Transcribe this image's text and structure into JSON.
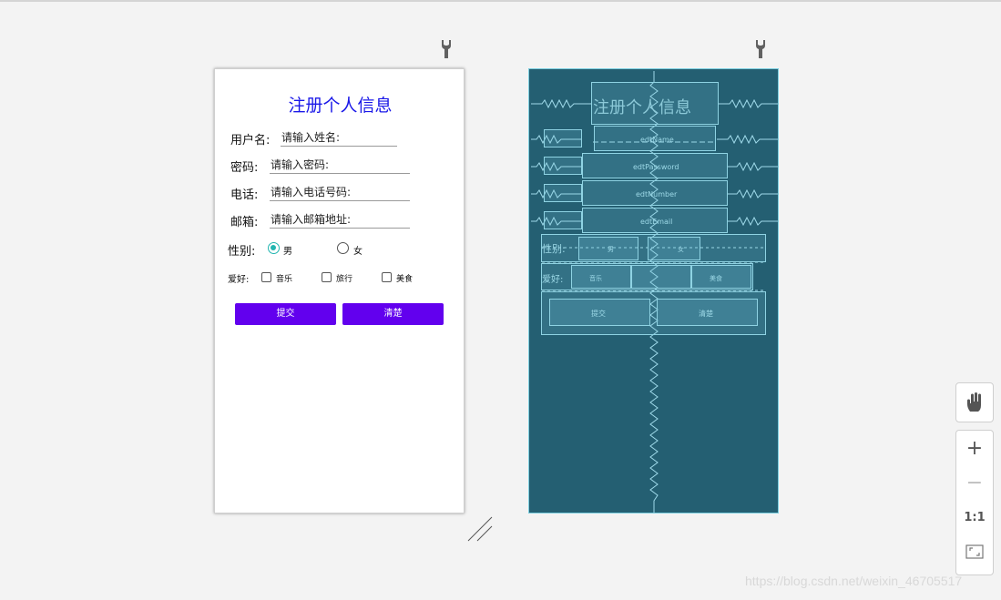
{
  "form": {
    "title": "注册个人信息",
    "username_label": "用户名:",
    "username_placeholder": "请输入姓名:",
    "password_label": "密码:",
    "password_placeholder": "请输入密码:",
    "phone_label": "电话:",
    "phone_placeholder": "请输入电话号码:",
    "email_label": "邮箱:",
    "email_placeholder": "请输入邮箱地址:",
    "gender_label": "性别:",
    "gender_options": [
      "男",
      "女"
    ],
    "gender_selected": "男",
    "hobby_label": "爱好:",
    "hobby_options": [
      "音乐",
      "旅行",
      "美食"
    ],
    "submit_label": "提交",
    "clear_label": "清楚"
  },
  "blueprint": {
    "title": "注册个人信息",
    "ids": [
      "edtName",
      "edtPassword",
      "edtNumber",
      "edtEmail"
    ],
    "gender_label": "性别:",
    "hobby_label": "爱好:",
    "option_labels": [
      "男",
      "女",
      "音乐",
      "美食"
    ],
    "submit_label": "提交",
    "clear_label": "清楚"
  },
  "tools": {
    "ratio_label": "1:1"
  },
  "watermark": "https://blog.csdn.net/weixin_46705517",
  "colors": {
    "title": "#1a18e8",
    "button": "#6200ee",
    "radio_accent": "#22b5b0",
    "blueprint_bg": "#245f72"
  }
}
